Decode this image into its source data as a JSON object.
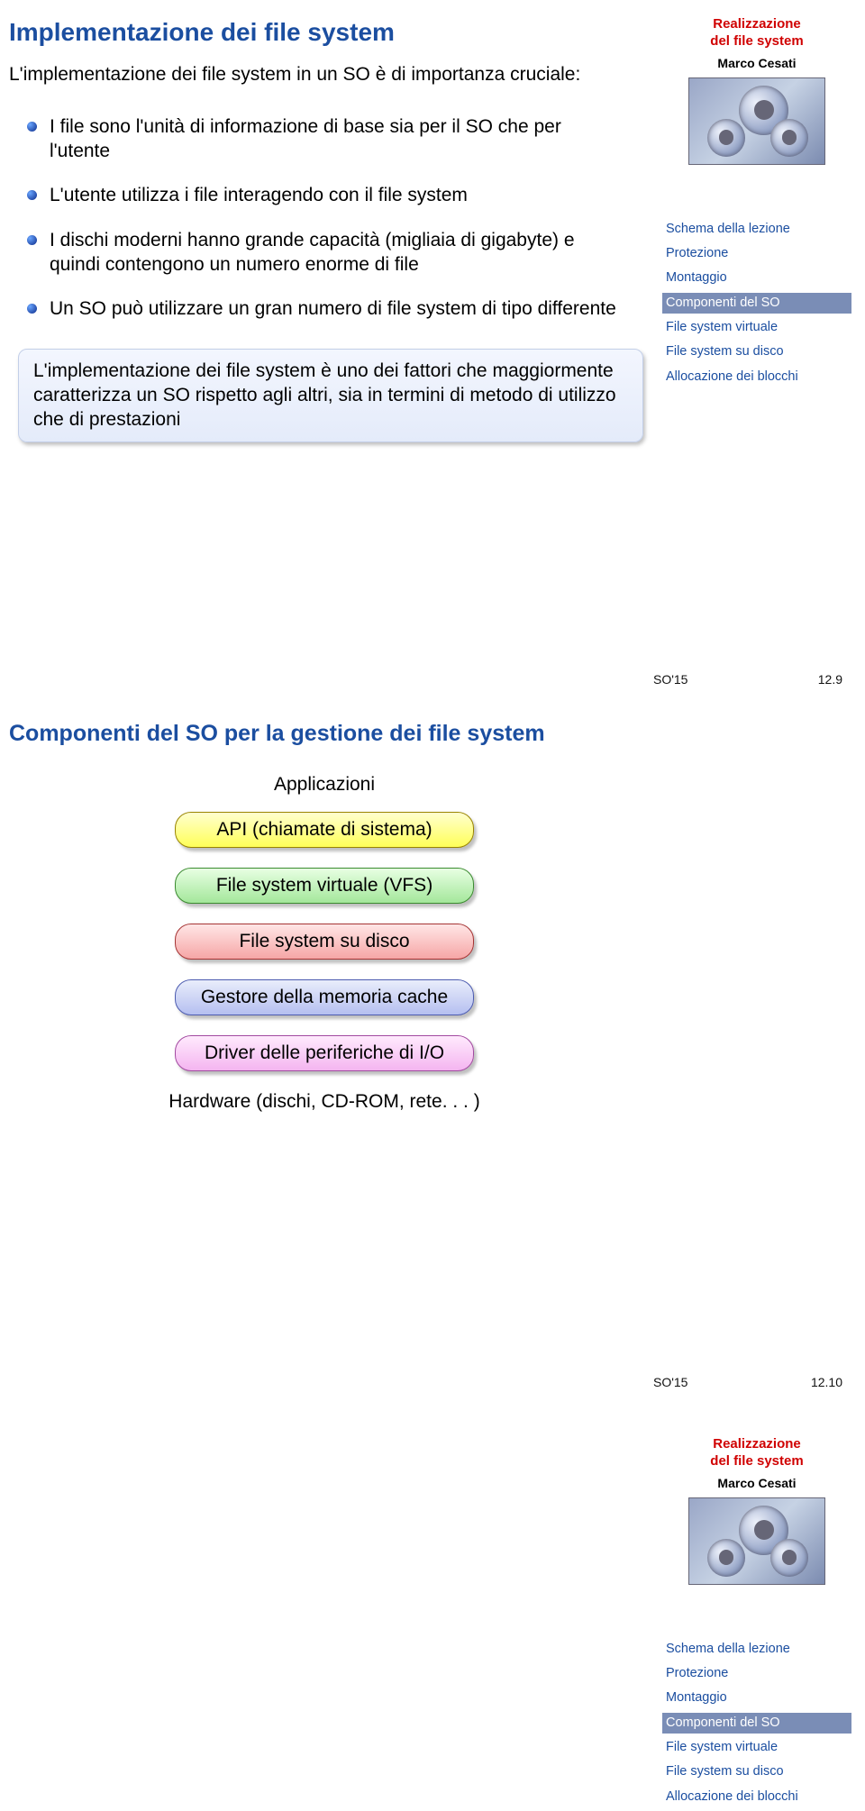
{
  "slide1": {
    "title": "Implementazione dei file system",
    "intro": "L'implementazione dei file system in un SO è di importanza cruciale:",
    "bullets": [
      "I file sono l'unità di informazione di base sia per il SO che per l'utente",
      "L'utente utilizza i file interagendo con il file system",
      "I dischi moderni hanno grande capacità (migliaia di gigabyte) e quindi contengono un numero enorme di file",
      "Un SO può utilizzare un gran numero di file system di tipo differente"
    ],
    "callout": "L'implementazione dei file system è uno dei fattori che maggiormente caratterizza un SO rispetto agli altri, sia in termini di metodo di utilizzo che di prestazioni",
    "footer_left": "SO'15",
    "footer_right": "12.9"
  },
  "slide2": {
    "title": "Componenti del SO per la gestione dei file system",
    "diagram": {
      "top": "Applicazioni",
      "layers": [
        "API (chiamate di sistema)",
        "File system virtuale (VFS)",
        "File system su disco",
        "Gestore della memoria cache",
        "Driver delle periferiche di I/O"
      ],
      "bottom": "Hardware (dischi, CD-ROM, rete. . . )"
    },
    "footer_left": "SO'15",
    "footer_right": "12.10"
  },
  "sidebar": {
    "title_line1": "Realizzazione",
    "title_line2": "del file system",
    "author": "Marco Cesati",
    "nav": [
      "Schema della lezione",
      "Protezione",
      "Montaggio",
      "Componenti del SO",
      "File system virtuale",
      "File system su disco",
      "Allocazione dei blocchi"
    ],
    "active_index": 3
  }
}
